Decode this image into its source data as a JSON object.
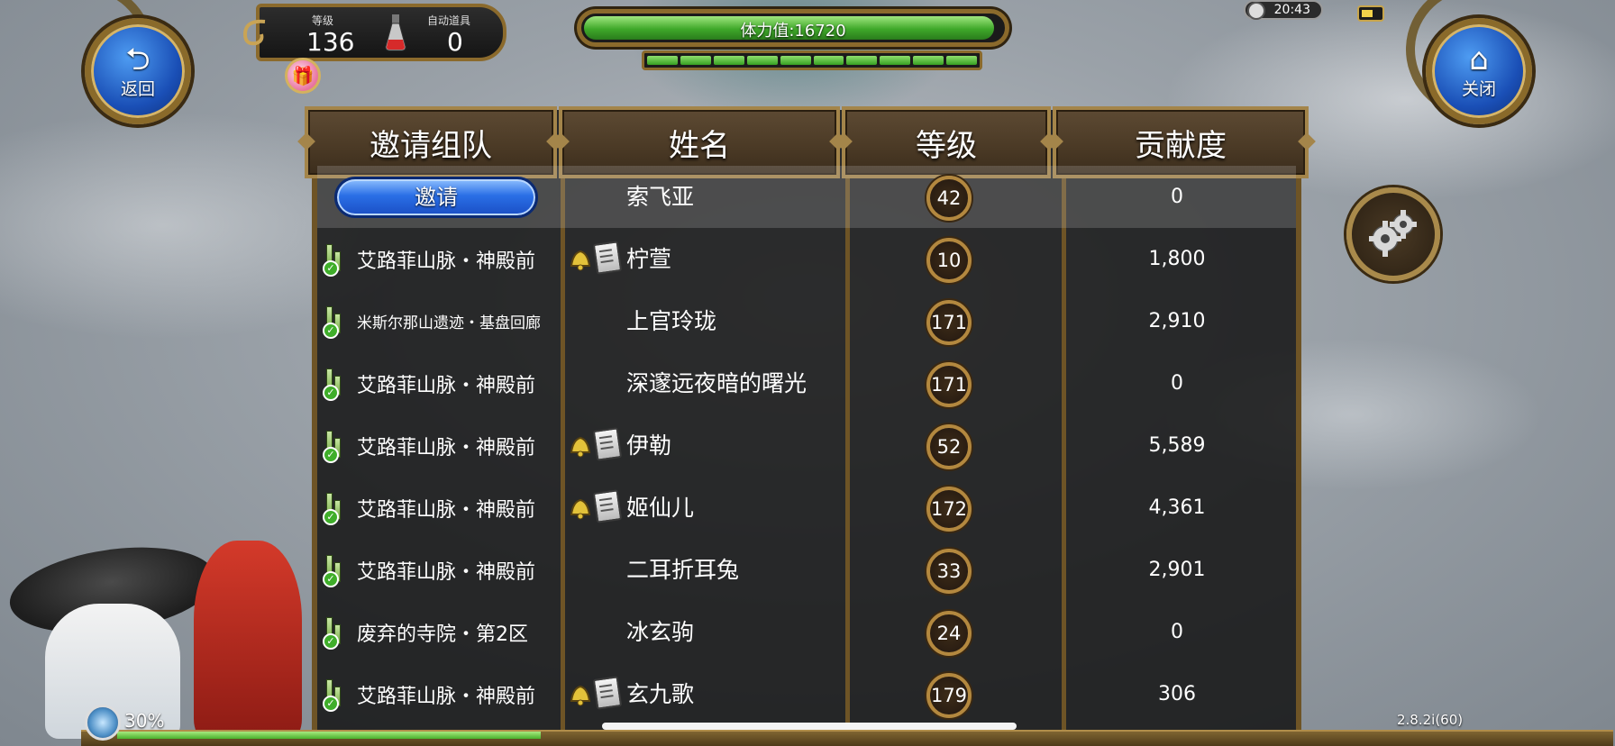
{
  "hud": {
    "back_label": "返回",
    "close_label": "关闭",
    "level_label": "等级",
    "level_value": "136",
    "auto_item_label": "自动道具",
    "auto_item_value": "0",
    "stamina_text": "体力值:16720",
    "stamina_fraction": 0.98,
    "clock": "20:43",
    "xp_percent": "30%",
    "version": "2.8.2i(60)"
  },
  "table": {
    "headers": [
      "邀请组队",
      "姓名",
      "等级",
      "贡献度"
    ],
    "invite_label": "邀请",
    "rows": [
      {
        "location": "",
        "invite": true,
        "badges": false,
        "name": "索飞亚",
        "level": "42",
        "contribution": "0",
        "highlight": true
      },
      {
        "location": "艾路菲山脉・神殿前",
        "invite": false,
        "badges": true,
        "name": "柠萱",
        "level": "10",
        "contribution": "1,800"
      },
      {
        "location": "米斯尔那山遗迹・基盘回廊",
        "invite": false,
        "badges": false,
        "name": "上官玲珑",
        "level": "171",
        "contribution": "2,910",
        "small": true
      },
      {
        "location": "艾路菲山脉・神殿前",
        "invite": false,
        "badges": false,
        "name": "深邃远夜暗的曙光",
        "level": "171",
        "contribution": "0"
      },
      {
        "location": "艾路菲山脉・神殿前",
        "invite": false,
        "badges": true,
        "name": "伊勒",
        "level": "52",
        "contribution": "5,589"
      },
      {
        "location": "艾路菲山脉・神殿前",
        "invite": false,
        "badges": true,
        "name": "姬仙儿",
        "level": "172",
        "contribution": "4,361"
      },
      {
        "location": "艾路菲山脉・神殿前",
        "invite": false,
        "badges": false,
        "name": "二耳折耳兔",
        "level": "33",
        "contribution": "2,901"
      },
      {
        "location": "废弃的寺院・第2区",
        "invite": false,
        "badges": false,
        "name": "冰玄驹",
        "level": "24",
        "contribution": "0"
      },
      {
        "location": "艾路菲山脉・神殿前",
        "invite": false,
        "badges": true,
        "name": "玄九歌",
        "level": "179",
        "contribution": "306"
      }
    ]
  }
}
